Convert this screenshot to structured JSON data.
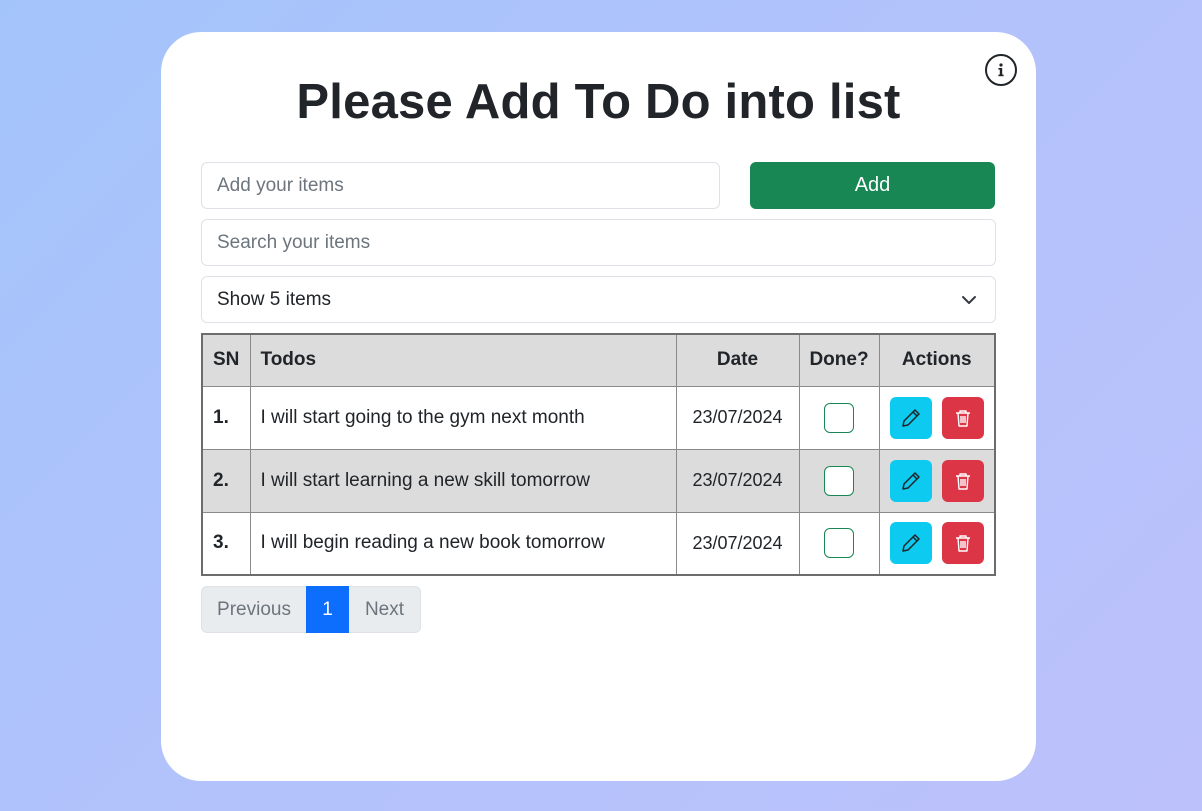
{
  "header": {
    "title": "Please Add To Do into list",
    "info_icon": "info-circle-icon"
  },
  "add_form": {
    "input_placeholder": "Add your items",
    "input_value": "",
    "button_label": "Add"
  },
  "search": {
    "placeholder": "Search your items",
    "value": ""
  },
  "page_size_select": {
    "selected": "Show 5 items",
    "icon": "chevron-down-icon"
  },
  "table": {
    "headers": {
      "sn": "SN",
      "todos": "Todos",
      "date": "Date",
      "done": "Done?",
      "actions": "Actions"
    },
    "rows": [
      {
        "sn": "1.",
        "todo": "I will start going to the gym next month",
        "date": "23/07/2024",
        "done": false
      },
      {
        "sn": "2.",
        "todo": "I will start learning a new skill tomorrow",
        "date": "23/07/2024",
        "done": false
      },
      {
        "sn": "3.",
        "todo": "I will begin reading a new book tomorrow",
        "date": "23/07/2024",
        "done": false
      }
    ]
  },
  "pagination": {
    "previous_label": "Previous",
    "current_page": "1",
    "next_label": "Next"
  },
  "colors": {
    "add_button": "#198754",
    "edit_button": "#0dcaf0",
    "delete_button": "#dc3545",
    "active_page": "#0d6efd"
  }
}
